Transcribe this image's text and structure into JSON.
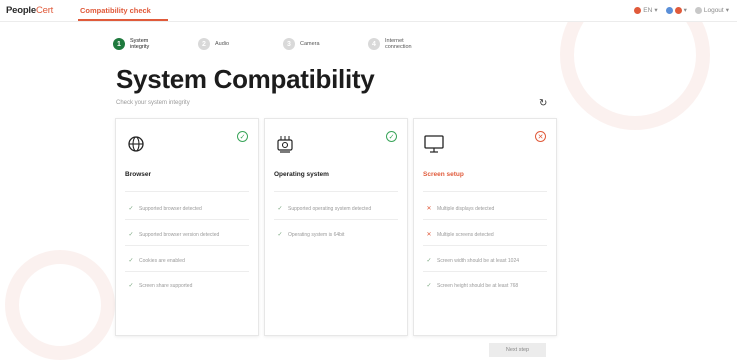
{
  "header": {
    "logo_main": "People",
    "logo_accent": "Cert",
    "tab_label": "Compatibility check",
    "top_right": [
      {
        "icon": "flag-icon",
        "label": "EN",
        "color": "#e05a3a"
      },
      {
        "icon": "help-icon",
        "label": "",
        "color": "#5a8fd8"
      },
      {
        "icon": "user-icon",
        "label": "Logout",
        "color": "#c8c8c8"
      }
    ]
  },
  "stepper": [
    {
      "number": "1",
      "label": "System integrity",
      "active": true
    },
    {
      "number": "2",
      "label": "Audio",
      "active": false
    },
    {
      "number": "3",
      "label": "Camera",
      "active": false
    },
    {
      "number": "4",
      "label": "Internet connection",
      "active": false
    }
  ],
  "page": {
    "title": "System Compatibility",
    "subtitle": "Check your system integrity",
    "refresh_icon": "refresh-icon"
  },
  "cards": [
    {
      "name": "browser",
      "icon": "globe-icon",
      "title": "Browser",
      "status": "ok",
      "items": [
        {
          "mark": "ok",
          "text": "Supported browser detected"
        },
        {
          "mark": "ok",
          "text": "Supported browser version detected"
        },
        {
          "mark": "ok",
          "text": "Cookies are enabled"
        },
        {
          "mark": "ok",
          "text": "Screen share supported"
        }
      ]
    },
    {
      "name": "operating-system",
      "icon": "os-icon",
      "title": "Operating system",
      "status": "ok",
      "items": [
        {
          "mark": "ok",
          "text": "Supported operating system detected"
        },
        {
          "mark": "ok",
          "text": "Operating system is 64bit"
        }
      ]
    },
    {
      "name": "screen-setup",
      "icon": "monitor-icon",
      "title": "Screen setup",
      "status": "err",
      "items": [
        {
          "mark": "err",
          "text": "Multiple displays detected"
        },
        {
          "mark": "err",
          "text": "Multiple screens detected"
        },
        {
          "mark": "ok",
          "text": "Screen width should be at least 1024"
        },
        {
          "mark": "ok",
          "text": "Screen height should be at least 768"
        }
      ]
    }
  ],
  "footer": {
    "next_label": "Next step"
  }
}
